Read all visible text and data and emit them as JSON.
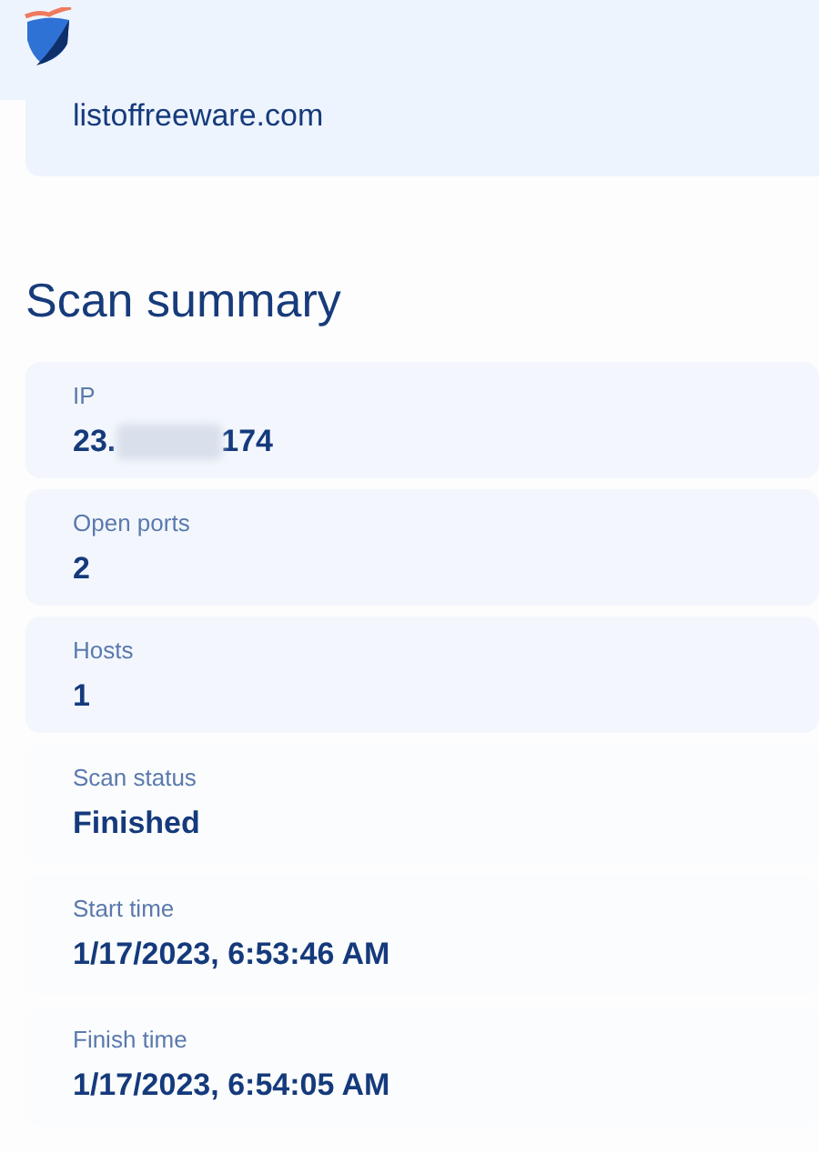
{
  "header": {
    "domain": "listoffreeware.com"
  },
  "title": "Scan summary",
  "fields": [
    {
      "kind": "card",
      "label": "IP",
      "value": "23.",
      "redacted": true,
      "value_end": "174"
    },
    {
      "kind": "card",
      "label": "Open ports",
      "value": "2"
    },
    {
      "kind": "card",
      "label": "Hosts",
      "value": "1"
    },
    {
      "kind": "plain",
      "label": "Scan status",
      "value": "Finished"
    },
    {
      "kind": "plain",
      "label": "Start time",
      "value": "1/17/2023, 6:53:46 AM"
    },
    {
      "kind": "plain",
      "label": "Finish time",
      "value": "1/17/2023, 6:54:05 AM"
    }
  ]
}
